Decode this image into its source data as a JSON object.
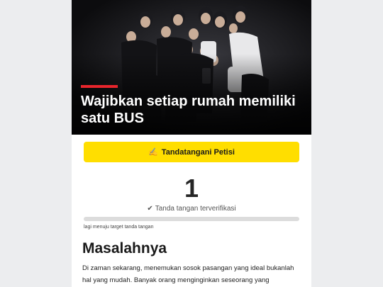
{
  "hero": {
    "title": "Wajibkan setiap rumah memiliki satu BUS",
    "image": "group-photo",
    "accent_color": "#e8252c"
  },
  "cta": {
    "icon": "writing-hand-icon",
    "icon_glyph": "✍",
    "label": "Tandatangani Petisi",
    "color": "#ffde00"
  },
  "signatures": {
    "count": "1",
    "verified_icon": "✔",
    "verified_label": "Tanda tangan terverifikasi",
    "progress_fraction": 0.0,
    "target_note": "lagi menuju target tanda tangan"
  },
  "problem": {
    "heading": "Masalahnya",
    "body": "Di zaman sekarang, menemukan sosok pasangan yang ideal bukanlah hal yang mudah. Banyak orang menginginkan seseorang yang penyayang, bertanggung"
  }
}
